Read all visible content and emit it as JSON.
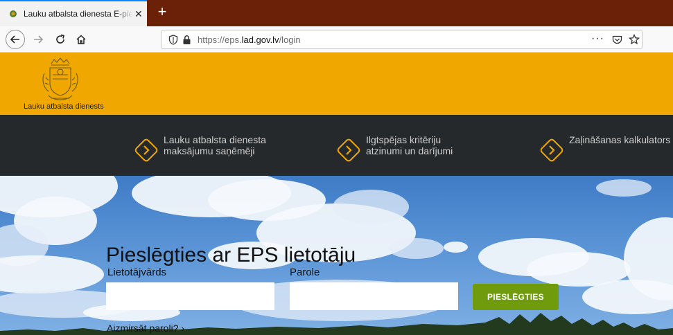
{
  "browser": {
    "tab_title": "Lauku atbalsta dienesta E-pieteikšanās",
    "tab_close": "✕",
    "new_tab": "+",
    "url_prefix": "https://eps.",
    "url_host": "lad.gov.lv",
    "url_path": "/login",
    "page_actions": "···"
  },
  "header": {
    "logo_text": "Lauku atbalsta dienests"
  },
  "nav": {
    "items": [
      {
        "line1": "Lauku atbalsta dienesta",
        "line2": "maksājumu saņēmēji"
      },
      {
        "line1": "Ilgtspējas kritēriju",
        "line2": "atzinumi un darījumi"
      },
      {
        "line1": "Zaļināšanas kalkulators",
        "line2": ""
      }
    ]
  },
  "login": {
    "title": "Pieslēgties ar EPS lietotāju",
    "username_label": "Lietotājvārds",
    "username_value": "",
    "password_label": "Parole",
    "password_value": "",
    "submit_label": "PIESLĒGTIES",
    "forgot_label": "Aizmirsāt paroli? ›"
  },
  "colors": {
    "tabbar": "#6b2008",
    "header": "#f0a800",
    "nav_bg": "#25292c",
    "accent": "#f0a800",
    "button": "#6f9b0c"
  }
}
